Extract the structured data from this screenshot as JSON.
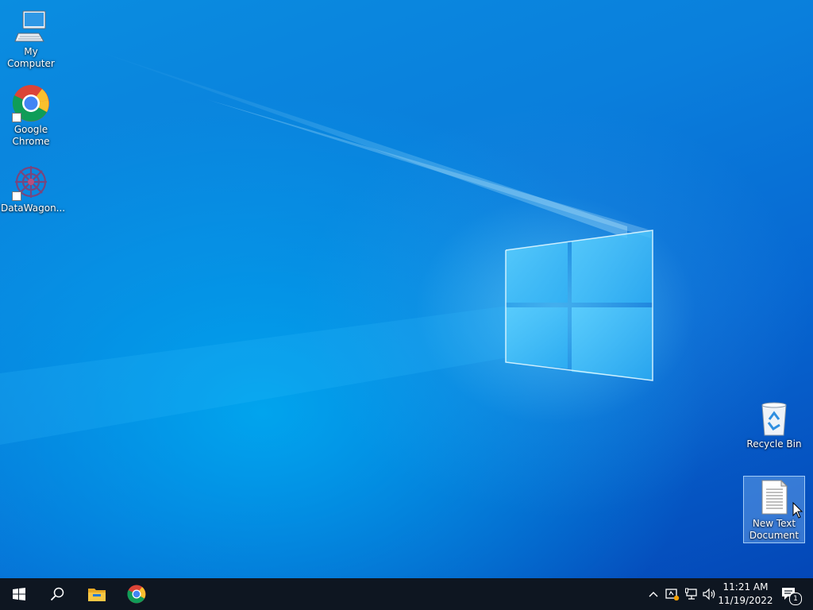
{
  "desktop": {
    "icons": [
      {
        "label": "My Computer",
        "icon": "computer-icon"
      },
      {
        "label": "Google Chrome",
        "icon": "chrome-icon"
      },
      {
        "label": "DataWagon...",
        "icon": "datawagon-icon"
      },
      {
        "label": "Recycle Bin",
        "icon": "recycle-bin-icon"
      },
      {
        "label": "New Text Document",
        "icon": "text-document-icon"
      }
    ]
  },
  "taskbar": {
    "buttons": [
      {
        "name": "start",
        "icon": "windows-logo-icon"
      },
      {
        "name": "search",
        "icon": "search-icon"
      },
      {
        "name": "file-explorer",
        "icon": "folder-icon"
      },
      {
        "name": "chrome",
        "icon": "chrome-icon"
      }
    ],
    "tray": {
      "time": "11:21 AM",
      "date": "11/19/2022",
      "notification_count": "1"
    }
  },
  "colors": {
    "taskbar": "#0e1621",
    "accent": "#0078d7"
  }
}
